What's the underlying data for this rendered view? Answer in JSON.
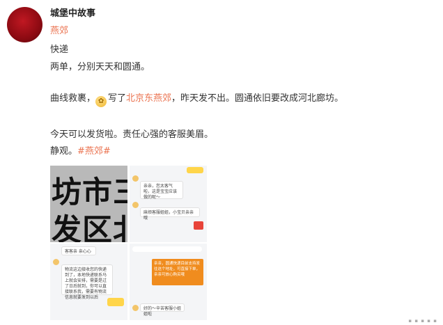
{
  "post": {
    "author": "城堡中故事",
    "tag_line": "燕郊",
    "lines": {
      "l1": "快递",
      "l2": "两单，分别天天和圆通。",
      "l3_a": "曲线救裹，",
      "l3_b": "写了",
      "l3_link": "北京东燕郊",
      "l3_c": "，昨天发不出。圆通依旧要改成河北廊坊。",
      "l4": "今天可以发货啦。责任心强的客服美眉。",
      "l5_a": "静观。",
      "l5_hashtag": "#燕郊#"
    }
  },
  "images": {
    "c1_row1": "坊市三",
    "c1_row2": "发区北",
    "c2_bubble1": "亲亲，您太客气啦，这是宝宝应该做的呢～",
    "c2_bubble2": "麻烦客服姐姐，小宝贝亲亲哦",
    "c3_bubble1": "客客亲 亲心心",
    "c3_bubble2": "物流这边接收您的快递到了，本地快递联系马上就会安排，需要是过了日后就到，你可以直接联系我，需要有物流信息就要发到以后",
    "c4_bubble": "亲亲，圆通快递目前支持发往这个地址，可直接下单，亲亲可放心购买哦",
    "c4_bottom": "好的～辛苦客服小姐姐啦"
  },
  "colors": {
    "accent": "#eb7350",
    "avatar": "#a4111a"
  }
}
